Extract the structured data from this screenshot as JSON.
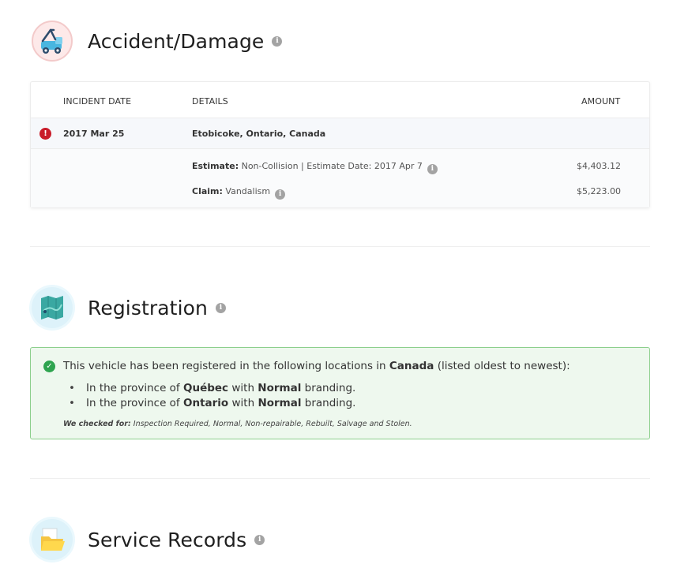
{
  "accident": {
    "title": "Accident/Damage",
    "headers": {
      "date": "INCIDENT DATE",
      "details": "DETAILS",
      "amount": "AMOUNT"
    },
    "incident": {
      "date": "2017 Mar 25",
      "location": "Etobicoke, Ontario, Canada",
      "estimate_label": "Estimate:",
      "estimate_text": "Non-Collision | Estimate Date: 2017 Apr 7",
      "estimate_amount": "$4,403.12",
      "claim_label": "Claim:",
      "claim_text": "Vandalism",
      "claim_amount": "$5,223.00"
    }
  },
  "registration": {
    "title": "Registration",
    "intro_prefix": "This vehicle has been registered in the following locations in ",
    "intro_country": "Canada",
    "intro_suffix": " (listed oldest to newest):",
    "items": [
      {
        "prefix": "In the province of ",
        "province": "Québec",
        "mid": " with ",
        "brand": "Normal",
        "suffix": " branding."
      },
      {
        "prefix": "In the province of ",
        "province": "Ontario",
        "mid": " with ",
        "brand": "Normal",
        "suffix": " branding."
      }
    ],
    "checked_label": "We checked for:",
    "checked_text": " Inspection Required, Normal, Non-repairable, Rebuilt, Salvage and Stolen."
  },
  "service": {
    "title": "Service Records"
  },
  "icons": {
    "info": "info-icon",
    "alert": "alert-icon",
    "check": "check-circle-icon",
    "accident": "tow-truck-icon",
    "registration": "map-icon",
    "service": "folder-icon"
  },
  "colors": {
    "alert": "#c91c2a",
    "success": "#2ea44f",
    "success_bg": "#eef8ee",
    "success_border": "#8ccf8c"
  }
}
